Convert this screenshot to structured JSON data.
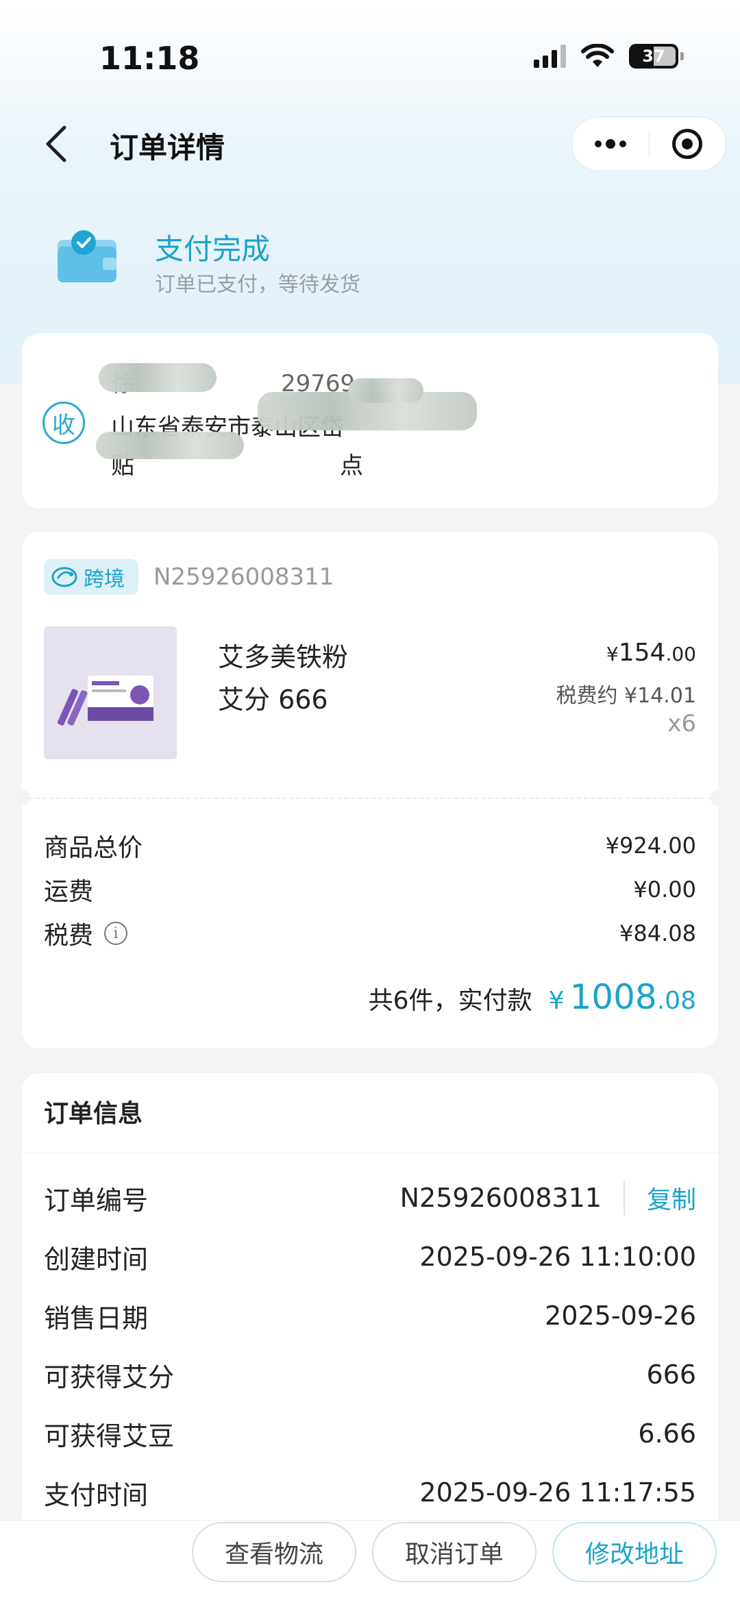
{
  "status_bar": {
    "time": "11:18",
    "battery": "37"
  },
  "nav": {
    "title": "订单详情"
  },
  "status": {
    "title": "支付完成",
    "subtitle": "订单已支付，等待发货"
  },
  "address": {
    "badge": "收",
    "name_prefix": "徐",
    "phone_tail": "29769",
    "line1_visible": "山东省泰安市泰山区岱",
    "line2_visible": "贴",
    "line2_tail": "点"
  },
  "order_card": {
    "tag": "跨境",
    "order_no": "N25926008311",
    "product": {
      "name": "艾多美铁粉",
      "spec": "艾分 666",
      "price_currency": "¥",
      "price_int": "154",
      "price_dec": ".00",
      "tax": "税费约 ¥14.01",
      "qty": "x6"
    },
    "summary": [
      {
        "label": "商品总价",
        "value": "¥924.00"
      },
      {
        "label": "运费",
        "value": "¥0.00"
      },
      {
        "label": "税费",
        "value": "¥84.08"
      }
    ],
    "total_label": "共6件，实付款",
    "total_currency": "¥",
    "total_int": "1008",
    "total_dec": ".08"
  },
  "order_info": {
    "title": "订单信息",
    "rows": [
      {
        "label": "订单编号",
        "value": "N25926008311"
      },
      {
        "label": "创建时间",
        "value": "2025-09-26 11:10:00"
      },
      {
        "label": "销售日期",
        "value": "2025-09-26"
      },
      {
        "label": "可获得艾分",
        "value": "666"
      },
      {
        "label": "可获得艾豆",
        "value": "6.66"
      },
      {
        "label": "支付时间",
        "value": "2025-09-26 11:17:55"
      }
    ],
    "copy_label": "复制"
  },
  "actions": {
    "logistics": "查看物流",
    "cancel": "取消订单",
    "modify_address": "修改地址"
  },
  "colors": {
    "accent": "#1ba4c9",
    "background": "#f3f4f6"
  }
}
